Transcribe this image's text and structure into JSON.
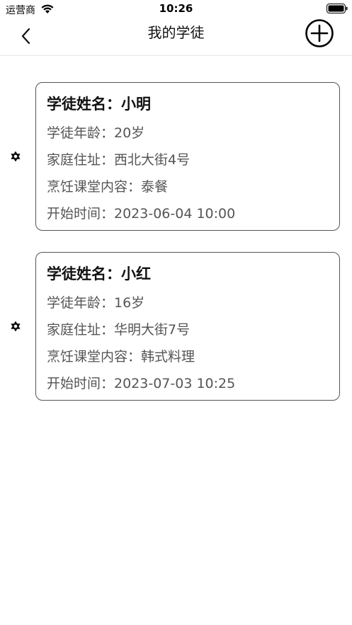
{
  "status_bar": {
    "carrier": "运营商",
    "time": "10:26",
    "wifi_icon": "wifi-icon",
    "battery_icon": "battery-icon"
  },
  "nav": {
    "title": "我的学徒",
    "back_icon": "chevron-left-icon",
    "add_icon": "plus-circle-icon"
  },
  "apprentices": [
    {
      "name_line": "学徒姓名：小明",
      "age_line": "学徒年龄：20岁",
      "address_line": "家庭住址：西北大街4号",
      "course_line": "烹饪课堂内容：泰餐",
      "start_line": "开始时间：2023-06-04 10:00"
    },
    {
      "name_line": "学徒姓名：小红",
      "age_line": "学徒年龄：16岁",
      "address_line": "家庭住址：华明大街7号",
      "course_line": "烹饪课堂内容：韩式料理",
      "start_line": "开始时间：2023-07-03 10:25"
    }
  ],
  "colors": {
    "card_border": "#555555",
    "info_text": "#555555",
    "title_text": "#111111"
  }
}
